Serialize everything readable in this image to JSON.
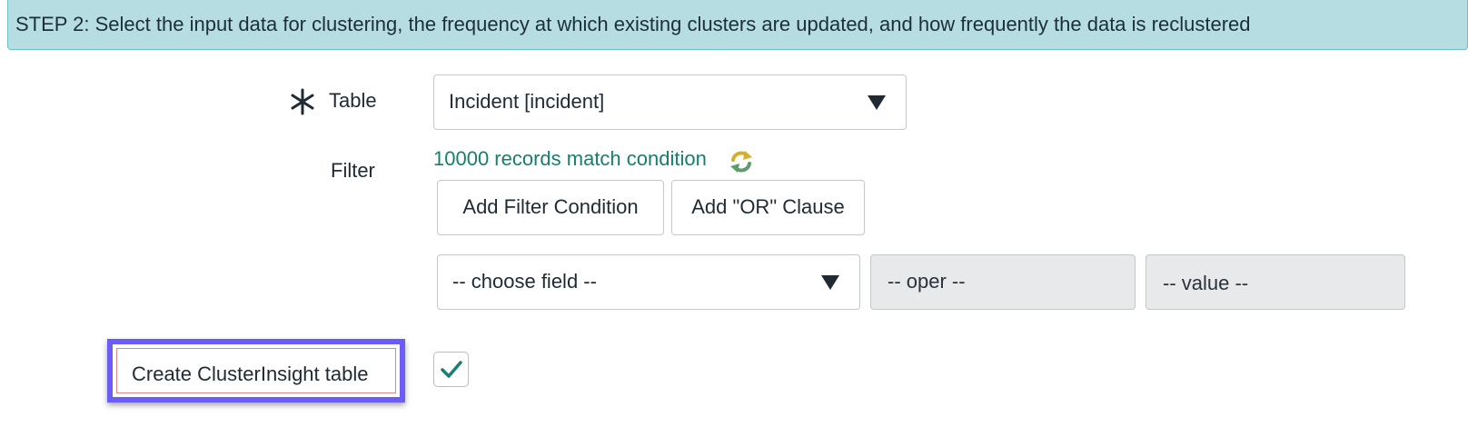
{
  "step_banner": {
    "text": "STEP 2: Select the input data for clustering, the frequency at which existing clusters are updated, and how frequently the data is reclustered"
  },
  "table_field": {
    "label": "Table",
    "value": "Incident [incident]",
    "mandatory": true
  },
  "filter": {
    "label": "Filter",
    "records_link": "10000 records match condition",
    "add_condition_label": "Add Filter Condition",
    "add_or_label": "Add \"OR\" Clause",
    "field_placeholder": "-- choose field --",
    "oper_placeholder": "-- oper --",
    "value_placeholder": "-- value --"
  },
  "cluster_insight": {
    "label": "Create ClusterInsight table",
    "checked": true
  },
  "colors": {
    "banner_bg": "#b6dde2",
    "link": "#157f6c",
    "highlight_frame": "#6b5cf6",
    "checkmark": "#1a7f73"
  }
}
